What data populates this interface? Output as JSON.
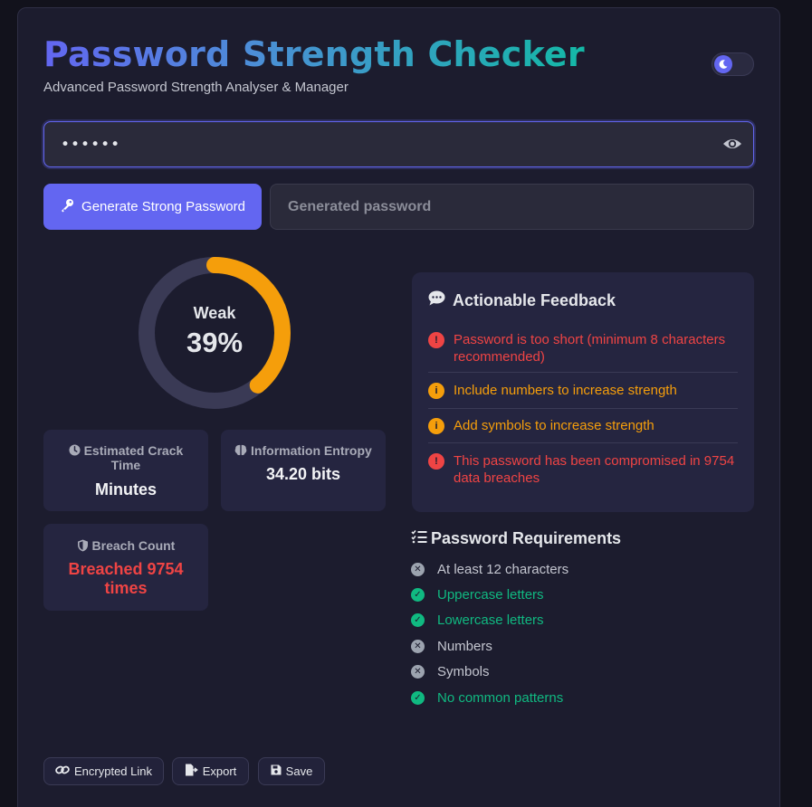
{
  "header": {
    "title": "Password Strength Checker",
    "subtitle": "Advanced Password Strength Analyser & Manager"
  },
  "password": {
    "value": "••••••",
    "masked": true
  },
  "generator": {
    "button_label": "Generate Strong Password",
    "output_placeholder": "Generated password"
  },
  "strength": {
    "label": "Weak",
    "percent_text": "39%",
    "percent": 39,
    "color": "#f59e0b"
  },
  "stats": {
    "crack_time_label": "Estimated Crack Time",
    "crack_time_value": "Minutes",
    "entropy_label": "Information Entropy",
    "entropy_value": "34.20 bits",
    "breach_label": "Breach Count",
    "breach_value": "Breached 9754 times"
  },
  "feedback": {
    "title": "Actionable Feedback",
    "items": [
      {
        "text": "Password is too short (minimum 8 characters recommended)",
        "severity": "error"
      },
      {
        "text": "Include numbers to increase strength",
        "severity": "info"
      },
      {
        "text": "Add symbols to increase strength",
        "severity": "info"
      },
      {
        "text": "This password has been compromised in 9754 data breaches",
        "severity": "error"
      }
    ]
  },
  "requirements": {
    "title": "Password Requirements",
    "items": [
      {
        "label": "At least 12 characters",
        "met": false
      },
      {
        "label": "Uppercase letters",
        "met": true
      },
      {
        "label": "Lowercase letters",
        "met": true
      },
      {
        "label": "Numbers",
        "met": false
      },
      {
        "label": "Symbols",
        "met": false
      },
      {
        "label": "No common patterns",
        "met": true
      }
    ]
  },
  "actions": {
    "encrypted_link": "Encrypted Link",
    "export": "Export",
    "save": "Save"
  },
  "colors": {
    "accent": "#6366f1",
    "error": "#ef4444",
    "warning": "#f59e0b",
    "success": "#10b981",
    "unmet": "#9ca3af"
  }
}
